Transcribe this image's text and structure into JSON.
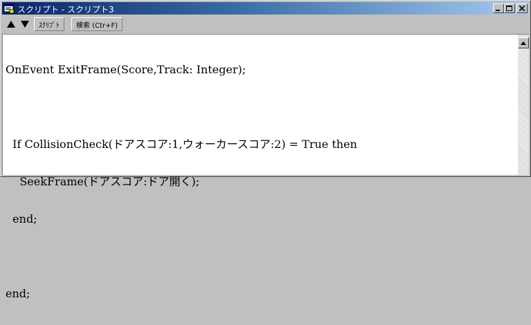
{
  "window": {
    "title": "スクリプト - スクリプト3"
  },
  "toolbar": {
    "up_icon": "triangle-up-icon",
    "down_icon": "triangle-down-icon",
    "script_button": "ｽｸﾘﾌﾟﾄ",
    "search_button": "検索 (Ctr+F)"
  },
  "editor": {
    "lines": [
      "OnEvent ExitFrame(Score,Track: Integer);",
      "",
      "  If CollisionCheck(ドアスコア:1,ウォーカースコア:2) = True then",
      "    SeekFrame(ドアスコア:ドア開く);",
      "  end;",
      "",
      "end;"
    ]
  },
  "colors": {
    "title_start": "#0a246a",
    "title_end": "#a6caf0",
    "chrome": "#c0c0c0"
  }
}
